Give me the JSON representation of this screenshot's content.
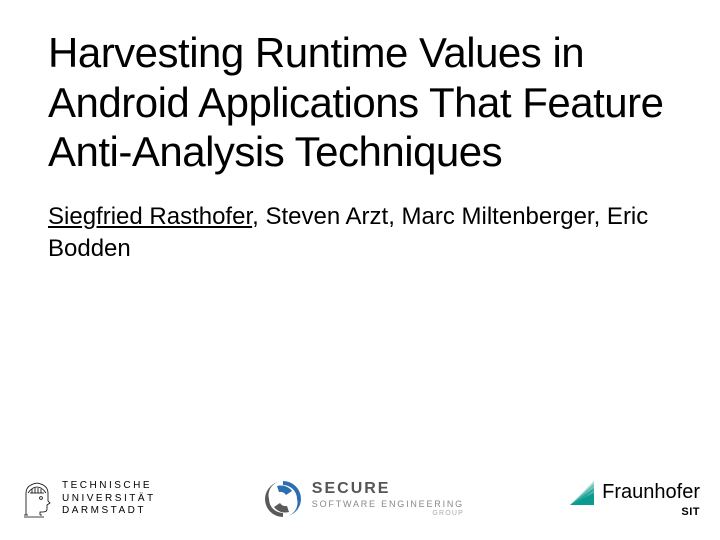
{
  "title": "Harvesting Runtime Values in Android Applications That Feature Anti-Analysis Techniques",
  "authors": {
    "underlined": "Siegfried Rasthofer",
    "rest": ", Steven Arzt, Marc Miltenberger, Eric Bodden"
  },
  "logos": {
    "tud": {
      "line1": "TECHNISCHE",
      "line2": "UNIVERSITÄT",
      "line3": "DARMSTADT"
    },
    "sse": {
      "line1": "SECURE",
      "line2": "SOFTWARE ENGINEERING",
      "group": "GROUP"
    },
    "fraunhofer": {
      "name": "Fraunhofer",
      "unit": "SIT"
    }
  }
}
